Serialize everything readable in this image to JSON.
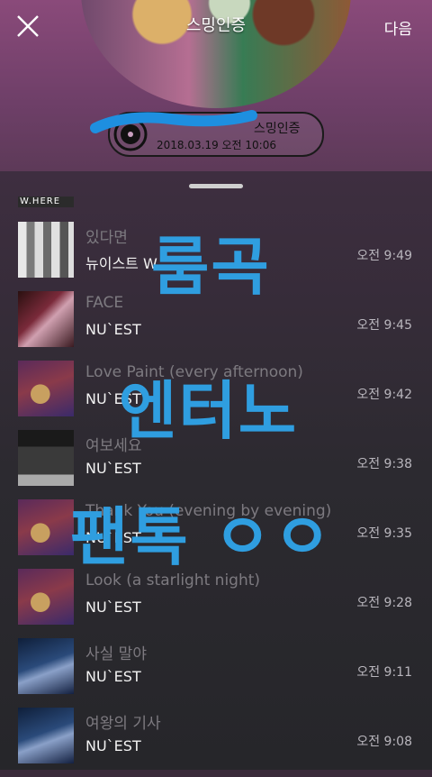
{
  "header": {
    "cover_title": "스밍인증",
    "next_label": "다음",
    "certificate": {
      "name": "스밍인증",
      "date": "2018.03.19 오전 10:06"
    }
  },
  "peek_album_text": "W.HERE",
  "tracks": [
    {
      "title": "있다면",
      "artist": "뉴이스트 W",
      "time": "오전 9:49"
    },
    {
      "title": "FACE",
      "artist": "NU`EST",
      "time": "오전 9:45"
    },
    {
      "title": "Love Paint (every afternoon)",
      "artist": "NU`EST",
      "time": "오전 9:42"
    },
    {
      "title": "여보세요",
      "artist": "NU`EST",
      "time": "오전 9:38"
    },
    {
      "title": "Thank You (evening by evening)",
      "artist": "NU`EST",
      "time": "오전 9:35"
    },
    {
      "title": "Look (a starlight night)",
      "artist": "NU`EST",
      "time": "오전 9:28"
    },
    {
      "title": "사실 말야",
      "artist": "NU`EST",
      "time": "오전 9:11"
    },
    {
      "title": "여왕의 기사",
      "artist": "NU`EST",
      "time": "오전 9:08"
    }
  ],
  "overlay_text": {
    "line1": "룸곡",
    "line2": "엔터노",
    "line3": "팬톡 ㅇㅇ"
  },
  "colors": {
    "overlay_blue": "#2f9ee0",
    "scribble_blue": "#1e8fe0"
  }
}
